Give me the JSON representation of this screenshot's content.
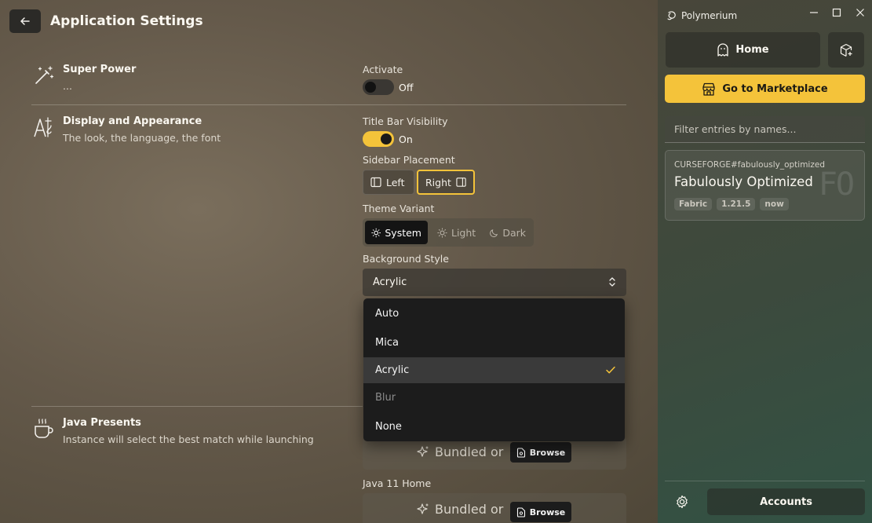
{
  "header": {
    "title": "Application Settings",
    "back_icon": "arrow-left-icon"
  },
  "sections": {
    "super_power": {
      "title": "Super Power",
      "desc": "...",
      "icon": "magic-wand-icon",
      "activate_label": "Activate",
      "activate_state": "Off"
    },
    "display": {
      "title": "Display and Appearance",
      "desc": "The look, the language, the font",
      "icon": "text-aa-icon",
      "titlebar_label": "Title Bar Visibility",
      "titlebar_state": "On",
      "sidebar_label": "Sidebar Placement",
      "sidebar_left": "Left",
      "sidebar_right": "Right",
      "theme_label": "Theme Variant",
      "theme_system": "System",
      "theme_light": "Light",
      "theme_dark": "Dark",
      "bg_label": "Background Style",
      "bg_value": "Acrylic",
      "bg_options": [
        "Auto",
        "Mica",
        "Acrylic",
        "Blur",
        "None"
      ]
    },
    "java": {
      "title": "Java Presents",
      "desc": "Instance will select the best match while launching",
      "icon": "coffee-cup-icon",
      "java11_label": "Java 11 Home",
      "bundled_text": "Bundled or",
      "browse_label": "Browse"
    }
  },
  "sidebar": {
    "app_name": "Polymerium",
    "home_label": "Home",
    "marketplace_label": "Go to Marketplace",
    "filter_placeholder": "Filter entries by names...",
    "entry": {
      "ref": "CURSEFORGE#fabulously_optimized",
      "name": "Fabulously Optimized",
      "monogram": "FO",
      "tags": [
        "Fabric",
        "1.21.5",
        "now"
      ]
    },
    "accounts_label": "Accounts"
  },
  "colors": {
    "accent": "#f4c33a",
    "dropdown_bg": "#1c1c1c"
  }
}
